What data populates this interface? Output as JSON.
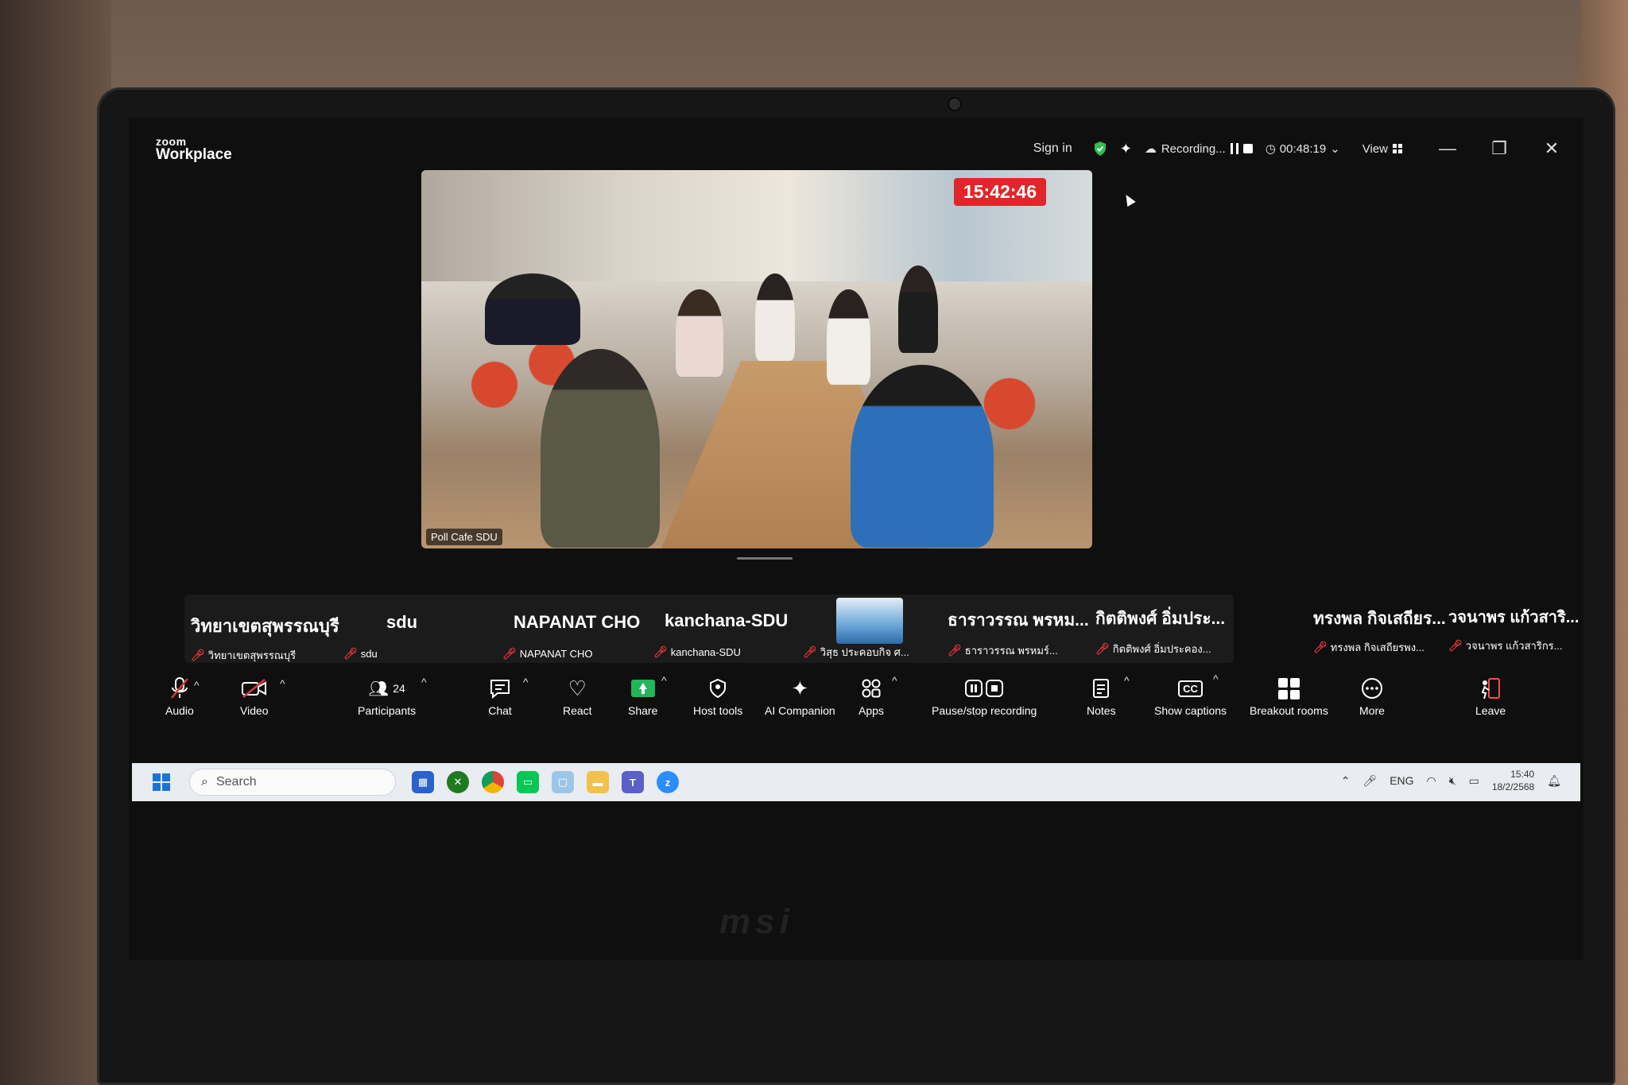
{
  "app": {
    "brand_small": "zoom",
    "brand_name": "Workplace"
  },
  "titlebar": {
    "sign_in": "Sign in",
    "recording_status": "Recording...",
    "elapsed_time": "00:48:19",
    "view_label": "View",
    "minimize": "—",
    "restore": "❐",
    "close": "✕"
  },
  "main_video": {
    "timestamp_overlay": "15:42:46",
    "participant_label": "Poll Cafe SDU"
  },
  "participants_strip": [
    {
      "display": "วิทยาเขตสุพรรณบุรี",
      "name": "วิทยาเขตสุพรรณบุรี"
    },
    {
      "display": "sdu",
      "name": "sdu"
    },
    {
      "display": "NAPANAT CHO",
      "name": "NAPANAT CHO"
    },
    {
      "display": "kanchana-SDU",
      "name": "kanchana-SDU"
    },
    {
      "display": "",
      "name": "วิสุธ ประคอบกิจ ศ..."
    },
    {
      "display": "ธาราวรรณ พรหม...",
      "name": "ธาราวรรณ พรหมร์..."
    },
    {
      "display": "กิตติพงศ์ อิ่มประ...",
      "name": "กิตติพงศ์ อิ่มประคอง..."
    },
    {
      "display": "ทรงพล กิจเสถียร...",
      "name": "ทรงพล กิจเสถียรพง..."
    },
    {
      "display": "วจนาพร แก้วสาริ...",
      "name": "วจนาพร แก้วสาริกร..."
    }
  ],
  "toolbar": {
    "audio": "Audio",
    "video": "Video",
    "participants": "Participants",
    "participants_count": "24",
    "chat": "Chat",
    "react": "React",
    "share": "Share",
    "host_tools": "Host tools",
    "ai_companion": "AI Companion",
    "apps": "Apps",
    "pause_stop_recording": "Pause/stop recording",
    "notes": "Notes",
    "show_captions": "Show captions",
    "breakout_rooms": "Breakout rooms",
    "more": "More",
    "leave": "Leave"
  },
  "taskbar": {
    "search_placeholder": "Search",
    "language": "ENG",
    "time": "15:40",
    "date": "18/2/2568",
    "apps": [
      "store-icon",
      "xbox-icon",
      "chrome-icon",
      "line-icon",
      "photos-icon",
      "file-explorer-icon",
      "teams-icon",
      "zoom-icon"
    ]
  },
  "device": {
    "brand": "msi"
  },
  "colors": {
    "recording_red": "#e0262a",
    "share_green": "#23b55b",
    "shield_green": "#2fbf4f",
    "mute_red": "#e0353a",
    "taskbar_bg": "#e9ecf1"
  }
}
